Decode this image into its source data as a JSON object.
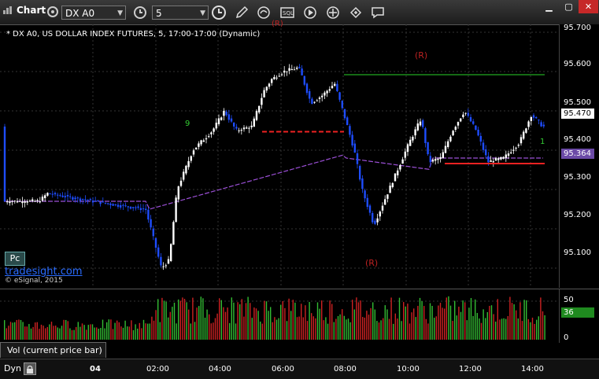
{
  "toolbar": {
    "chart_label": "Chart",
    "symbol_value": "DX A0",
    "interval_value": "5"
  },
  "chart": {
    "title": "* DX A0, US DOLLAR INDEX FUTURES, 5, 17:00-17:00 (Dynamic)",
    "pc_label": "Pc",
    "link_text": "tradesight.com",
    "copyright": "© eSignal, 2015",
    "annotation_r": "(R)",
    "seq_label": "9",
    "seq_label_1": "1"
  },
  "price_axis": {
    "labels": [
      "95.700",
      "95.600",
      "95.500",
      "95.400",
      "95.300",
      "95.200",
      "95.100"
    ],
    "current_price": "95.470",
    "ma_value": "95.364",
    "current_color": "#ffffff",
    "ma_color": "#9b7fd6"
  },
  "volume": {
    "study_label": "Vol (current price bar)",
    "axis_labels": [
      "50",
      "0"
    ],
    "current_value": "36",
    "current_color": "#33cc33"
  },
  "time_axis": {
    "labels": [
      "04",
      "02:00",
      "04:00",
      "06:00",
      "08:00",
      "10:00",
      "12:00",
      "14:00"
    ]
  },
  "bottom": {
    "dyn_label": "Dyn"
  },
  "chart_data": {
    "type": "candlestick",
    "ylim": [
      95.05,
      95.72
    ],
    "series_color_up": "#ffffff",
    "series_color_down": "#1e4dff",
    "resistance_line_green": 95.592,
    "support_line_red_dashed": 95.447,
    "support_line_red": 95.366,
    "moving_average_color": "#9b4fd6"
  }
}
